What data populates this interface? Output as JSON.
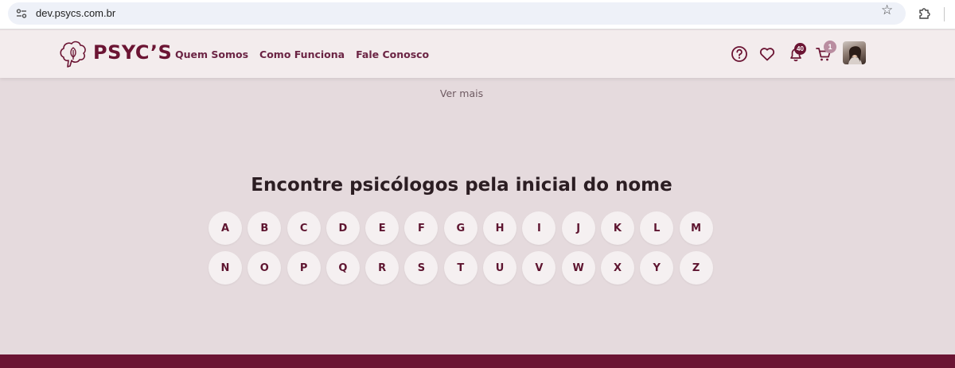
{
  "browser": {
    "url": "dev.psycs.com.br",
    "bookmark_icon": "star-icon",
    "extensions_icon": "puzzle-icon"
  },
  "header": {
    "brand": "PSYC’S",
    "nav": [
      {
        "label": "Quem Somos"
      },
      {
        "label": "Como Funciona"
      },
      {
        "label": "Fale Conosco"
      }
    ],
    "icons": {
      "help": "help-icon",
      "favorites": "heart-icon",
      "notifications": "bell-icon",
      "cart": "cart-icon"
    },
    "notification_count": "40",
    "cart_count": "1"
  },
  "main": {
    "ver_mais": "Ver mais",
    "title": "Encontre psicólogos pela inicial do nome",
    "letters": [
      "A",
      "B",
      "C",
      "D",
      "E",
      "F",
      "G",
      "H",
      "I",
      "J",
      "K",
      "L",
      "M",
      "N",
      "O",
      "P",
      "Q",
      "R",
      "S",
      "T",
      "U",
      "V",
      "W",
      "X",
      "Y",
      "Z"
    ]
  },
  "colors": {
    "brand": "#6b1433",
    "page_bg": "#e5dadd",
    "header_bg": "#f3eced",
    "letter_bg": "#f5f0f1",
    "cart_badge": "#b98da0"
  }
}
